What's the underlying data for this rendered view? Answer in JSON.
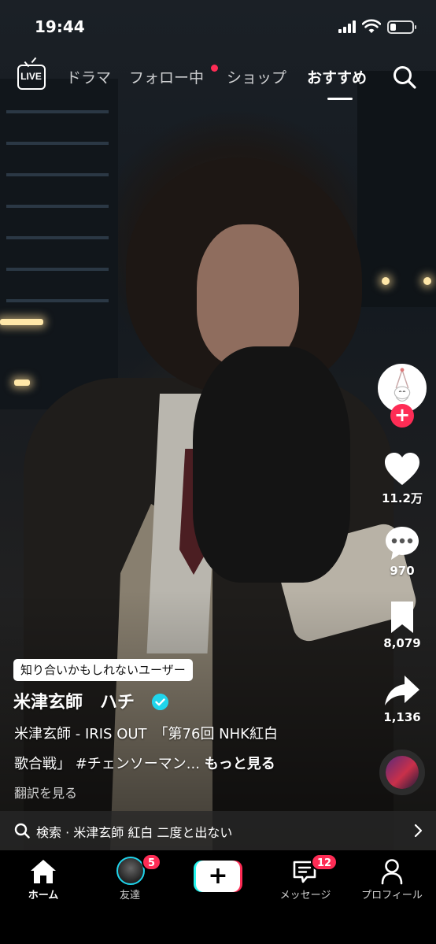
{
  "status_bar": {
    "time": "19:44"
  },
  "top_nav": {
    "live_label": "LIVE",
    "tabs": [
      {
        "label": "ドラマ",
        "active": false
      },
      {
        "label": "フォロー中",
        "active": false,
        "has_dot": true
      },
      {
        "label": "ショップ",
        "active": false
      },
      {
        "label": "おすすめ",
        "active": true
      }
    ]
  },
  "right_rail": {
    "likes": "11.2万",
    "comments": "970",
    "bookmarks": "8,079",
    "shares": "1,136"
  },
  "post": {
    "suggestion_chip": "知り合いかもしれないユーザー",
    "author": "米津玄師　ハチ",
    "verified": true,
    "caption_line1": "米津玄師 - IRIS OUT　「第76回 NHK紅白",
    "caption_line2": "歌合戦」 #チェンソーマン...",
    "more_label": "もっと見る",
    "translate_label": "翻訳を見る"
  },
  "search_suggestion": {
    "text": "検索 · 米津玄師 紅白 二度と出ない"
  },
  "bottom_nav": {
    "items": [
      {
        "label": "ホーム",
        "active": true
      },
      {
        "label": "友達",
        "badge": "5"
      },
      {
        "label": ""
      },
      {
        "label": "メッセージ",
        "badge": "12"
      },
      {
        "label": "プロフィール"
      }
    ]
  },
  "colors": {
    "accent": "#fe2c55",
    "cyan": "#25f4ee",
    "verified": "#20d5ec"
  }
}
